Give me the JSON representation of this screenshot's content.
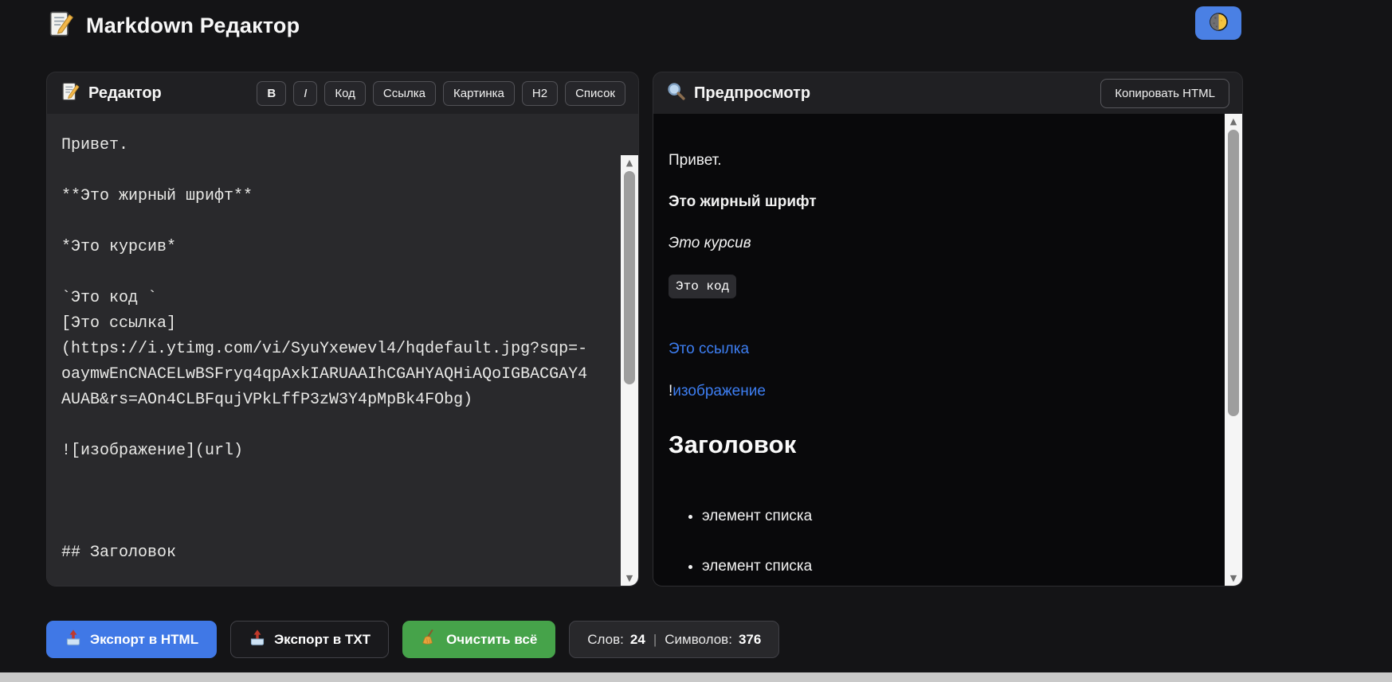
{
  "header": {
    "title": "Markdown Редактор"
  },
  "icons": {
    "app": "memo",
    "editor": "memo",
    "preview": "magnifying-glass",
    "theme_toggle": "first-quarter-moon",
    "export_html": "outbox-tray",
    "export_txt": "outbox-tray",
    "clear_all": "broom",
    "scroll_up": "▲",
    "scroll_down": "▼"
  },
  "editor": {
    "title": "Редактор",
    "toolbar": [
      "B",
      "I",
      "Код",
      "Ссылка",
      "Картинка",
      "H2",
      "Список"
    ],
    "content": "Привет.\n\n**Это жирный шрифт**\n\n*Это курсив*\n\n`Это код `\n[Это ссылка]\n(https://i.ytimg.com/vi/SyuYxewevl4/hqdefault.jpg?sqp=-oaymwEnCNACELwBSFryq4qpAxkIARUAAIhCGAHYAQHiAQoIGBACGAY4AUAB&rs=AOn4CLBFqujVPkLffP3zW3Y4pMpBk4FObg)\n\n![изображение](url)\n\n\n\n## Заголовок"
  },
  "preview": {
    "title": "Предпросмотр",
    "copy_button": "Копировать HTML",
    "blocks": [
      {
        "type": "p",
        "text": "Привет."
      },
      {
        "type": "bold",
        "text": "Это жирный шрифт"
      },
      {
        "type": "italic",
        "text": "Это курсив"
      },
      {
        "type": "code",
        "text": "Это код "
      },
      {
        "type": "link",
        "text": "Это ссылка"
      },
      {
        "type": "image-link",
        "prefix": "!",
        "text": "изображение"
      },
      {
        "type": "h2",
        "text": "Заголовок"
      },
      {
        "type": "li",
        "text": "элемент списка"
      },
      {
        "type": "li",
        "text": "элемент списка"
      }
    ]
  },
  "footer": {
    "export_html": "Экспорт в HTML",
    "export_txt": "Экспорт в TXT",
    "clear_all": "Очистить всё",
    "stats": {
      "words_label": "Слов:",
      "words_value": "24",
      "separator": "|",
      "chars_label": "Символов:",
      "chars_value": "376"
    }
  },
  "colors": {
    "accent_blue": "#4078e6",
    "theme_button_blue": "#4a80e4",
    "link_blue": "#3d7ef2",
    "green": "#46a34a",
    "page_bg": "#141416",
    "panel_bg": "#202023",
    "editor_bg": "#29292c",
    "preview_bg": "#09090b"
  }
}
